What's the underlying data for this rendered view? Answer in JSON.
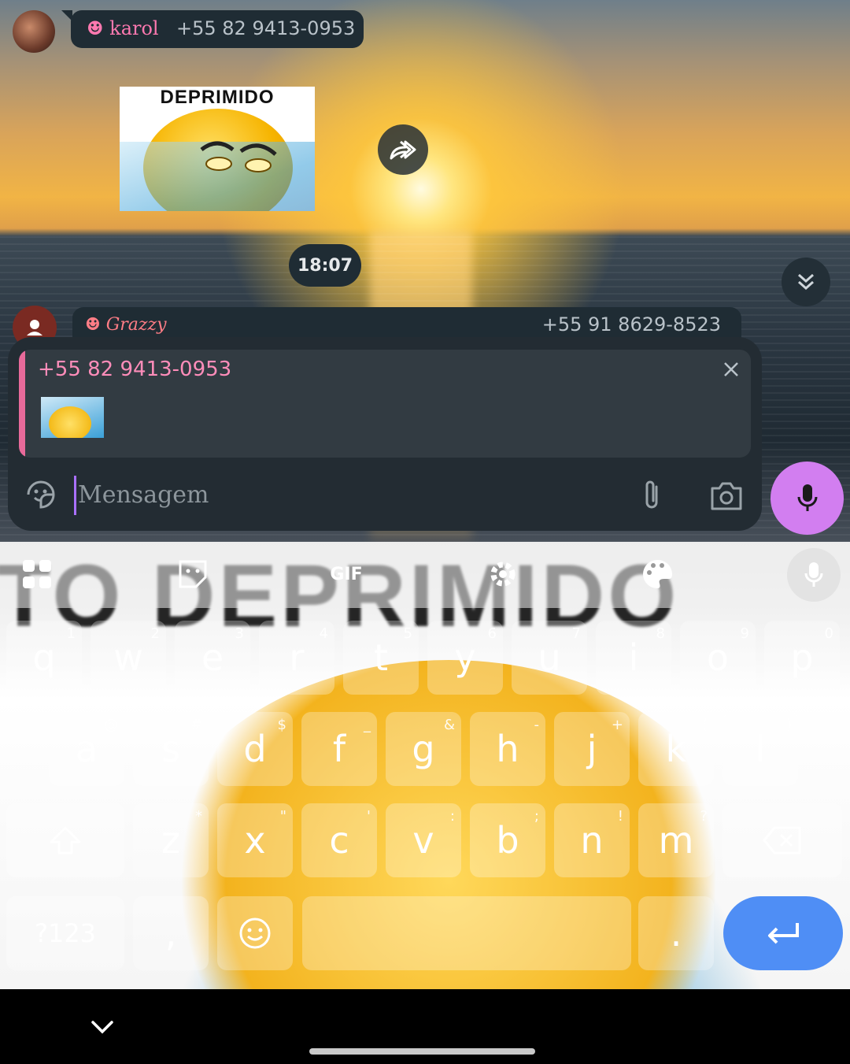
{
  "chat": {
    "messages": [
      {
        "sender_name": "☻ karol",
        "sender_phone": "+55 82 9413-0953",
        "sticker_text": "DEPRIMIDO"
      }
    ],
    "time_chip": "18:07",
    "partial_message": {
      "sender_name": "☻ Grazzy",
      "sender_phone": "+55 91 8629-8523"
    }
  },
  "composer": {
    "reply_phone": "+55 82 9413-0953",
    "placeholder": "Mensagem",
    "icons": {
      "sticker": "sticker-icon",
      "attach": "paperclip-icon",
      "camera": "camera-icon",
      "mic": "mic-icon",
      "close": "close-icon"
    },
    "accent_color": "#d27ef0"
  },
  "keyboard": {
    "background_text": "TO DEPRIMIDO",
    "toolbar": {
      "gif_label": "GIF",
      "icons": [
        "apps-grid-icon",
        "sticker-icon",
        "settings-gear-icon",
        "palette-icon",
        "mic-icon"
      ]
    },
    "row1": [
      {
        "key": "q",
        "hint": "1"
      },
      {
        "key": "w",
        "hint": "2"
      },
      {
        "key": "e",
        "hint": "3"
      },
      {
        "key": "r",
        "hint": "4"
      },
      {
        "key": "t",
        "hint": "5"
      },
      {
        "key": "y",
        "hint": "6"
      },
      {
        "key": "u",
        "hint": "7"
      },
      {
        "key": "i",
        "hint": "8"
      },
      {
        "key": "o",
        "hint": "9"
      },
      {
        "key": "p",
        "hint": "0"
      }
    ],
    "row2": [
      {
        "key": "a",
        "hint": "@"
      },
      {
        "key": "s",
        "hint": "#"
      },
      {
        "key": "d",
        "hint": "$"
      },
      {
        "key": "f",
        "hint": "_"
      },
      {
        "key": "g",
        "hint": "&"
      },
      {
        "key": "h",
        "hint": "-"
      },
      {
        "key": "j",
        "hint": "+"
      },
      {
        "key": "k",
        "hint": "("
      },
      {
        "key": "l",
        "hint": ")"
      }
    ],
    "row3": [
      {
        "key": "z",
        "hint": "*"
      },
      {
        "key": "x",
        "hint": "\""
      },
      {
        "key": "c",
        "hint": "'"
      },
      {
        "key": "v",
        "hint": ":"
      },
      {
        "key": "b",
        "hint": ";"
      },
      {
        "key": "n",
        "hint": "!"
      },
      {
        "key": "m",
        "hint": "?"
      }
    ],
    "symbols_label": "?123",
    "comma_label": ",",
    "period_label": ".",
    "enter_color": "#4f8ef5"
  }
}
